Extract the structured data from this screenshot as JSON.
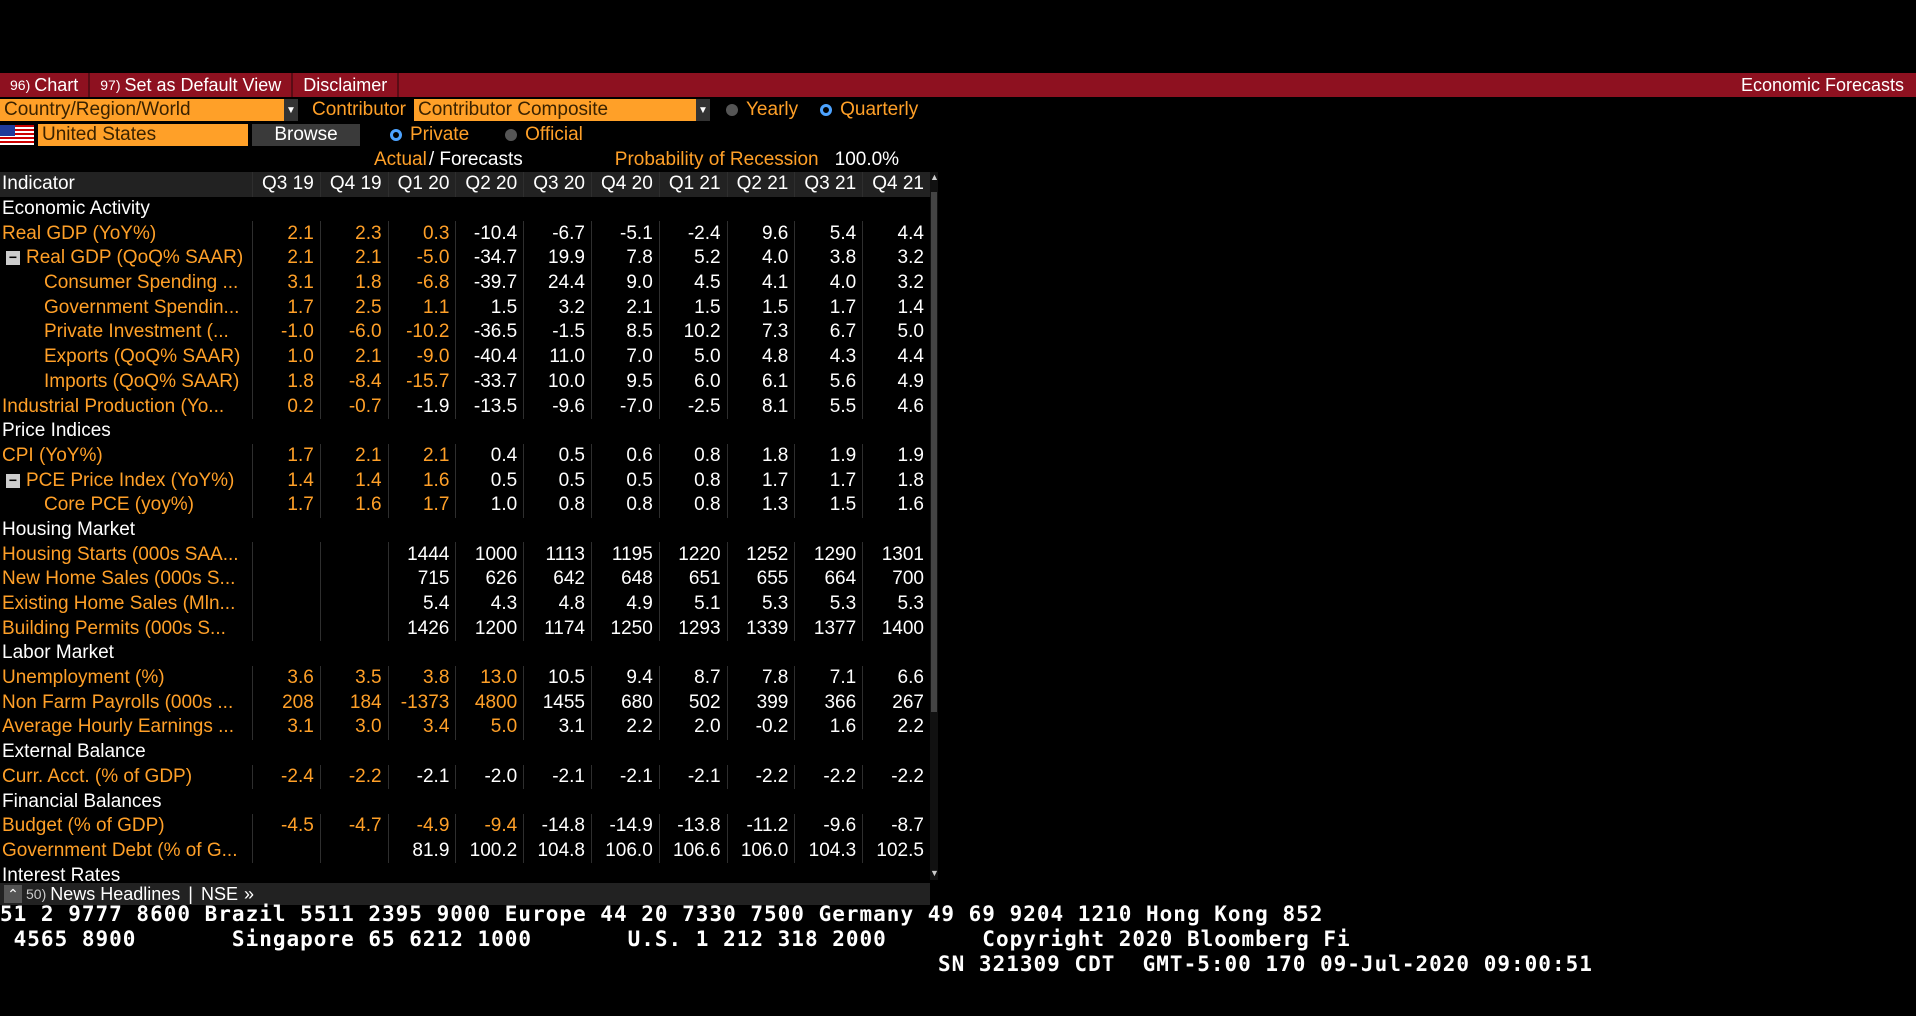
{
  "toolbar": {
    "chart_num": "96)",
    "chart_label": "Chart",
    "default_num": "97)",
    "default_label": "Set as Default View",
    "disclaimer_label": "Disclaimer",
    "title": "Economic Forecasts"
  },
  "controls": {
    "region_select": "Country/Region/World",
    "contributor_label": "Contributor",
    "contributor_select": "Contributor Composite",
    "yearly_label": "Yearly",
    "quarterly_label": "Quarterly",
    "country_field": "United States",
    "browse_label": "Browse",
    "private_label": "Private",
    "official_label": "Official",
    "actual_label": "Actual",
    "forecasts_label": "/ Forecasts",
    "recession_label": "Probability of Recession",
    "recession_value": "100.0%"
  },
  "table": {
    "header_label": "Indicator",
    "columns": [
      "Q3 19",
      "Q4 19",
      "Q1 20",
      "Q2 20",
      "Q3 20",
      "Q4 20",
      "Q1 21",
      "Q2 21",
      "Q3 21",
      "Q4 21"
    ],
    "rows": [
      {
        "type": "section",
        "label": "Economic Activity"
      },
      {
        "type": "data",
        "label": "Real GDP (YoY%)",
        "values": [
          "2.1",
          "2.3",
          "0.3",
          "-10.4",
          "-6.7",
          "-5.1",
          "-2.4",
          "9.6",
          "5.4",
          "4.4"
        ]
      },
      {
        "type": "data",
        "level": 1,
        "label": "Real GDP (QoQ% SAAR)",
        "values": [
          "2.1",
          "2.1",
          "-5.0",
          "-34.7",
          "19.9",
          "7.8",
          "5.2",
          "4.0",
          "3.8",
          "3.2"
        ]
      },
      {
        "type": "data",
        "level": 2,
        "label": "Consumer Spending ...",
        "values": [
          "3.1",
          "1.8",
          "-6.8",
          "-39.7",
          "24.4",
          "9.0",
          "4.5",
          "4.1",
          "4.0",
          "3.2"
        ]
      },
      {
        "type": "data",
        "level": 2,
        "label": "Government Spendin...",
        "values": [
          "1.7",
          "2.5",
          "1.1",
          "1.5",
          "3.2",
          "2.1",
          "1.5",
          "1.5",
          "1.7",
          "1.4"
        ]
      },
      {
        "type": "data",
        "level": 2,
        "label": "Private Investment (...",
        "values": [
          "-1.0",
          "-6.0",
          "-10.2",
          "-36.5",
          "-1.5",
          "8.5",
          "10.2",
          "7.3",
          "6.7",
          "5.0"
        ]
      },
      {
        "type": "data",
        "level": 2,
        "label": "Exports (QoQ% SAAR)",
        "values": [
          "1.0",
          "2.1",
          "-9.0",
          "-40.4",
          "11.0",
          "7.0",
          "5.0",
          "4.8",
          "4.3",
          "4.4"
        ]
      },
      {
        "type": "data",
        "level": 2,
        "label": "Imports (QoQ% SAAR)",
        "values": [
          "1.8",
          "-8.4",
          "-15.7",
          "-33.7",
          "10.0",
          "9.5",
          "6.0",
          "6.1",
          "5.6",
          "4.9"
        ]
      },
      {
        "type": "data",
        "label": "Industrial Production (Yo...",
        "values": [
          "0.2",
          "-0.7",
          "-1.9",
          "-13.5",
          "-9.6",
          "-7.0",
          "-2.5",
          "8.1",
          "5.5",
          "4.6"
        ]
      },
      {
        "type": "section",
        "label": "Price Indices"
      },
      {
        "type": "data",
        "label": "CPI (YoY%)",
        "values": [
          "1.7",
          "2.1",
          "2.1",
          "0.4",
          "0.5",
          "0.6",
          "0.8",
          "1.8",
          "1.9",
          "1.9"
        ]
      },
      {
        "type": "data",
        "level": 1,
        "label": "PCE Price Index (YoY%)",
        "values": [
          "1.4",
          "1.4",
          "1.6",
          "0.5",
          "0.5",
          "0.5",
          "0.8",
          "1.7",
          "1.7",
          "1.8"
        ]
      },
      {
        "type": "data",
        "level": 2,
        "label": "Core PCE (yoy%)",
        "values": [
          "1.7",
          "1.6",
          "1.7",
          "1.0",
          "0.8",
          "0.8",
          "0.8",
          "1.3",
          "1.5",
          "1.6"
        ]
      },
      {
        "type": "section",
        "label": "Housing Market"
      },
      {
        "type": "data",
        "label": "Housing Starts (000s SAA...",
        "values": [
          "",
          "",
          "1444",
          "1000",
          "1113",
          "1195",
          "1220",
          "1252",
          "1290",
          "1301"
        ]
      },
      {
        "type": "data",
        "label": "New Home Sales (000s S...",
        "values": [
          "",
          "",
          "715",
          "626",
          "642",
          "648",
          "651",
          "655",
          "664",
          "700"
        ]
      },
      {
        "type": "data",
        "label": "Existing Home Sales (Mln...",
        "values": [
          "",
          "",
          "5.4",
          "4.3",
          "4.8",
          "4.9",
          "5.1",
          "5.3",
          "5.3",
          "5.3"
        ]
      },
      {
        "type": "data",
        "label": "Building Permits (000s S...",
        "values": [
          "",
          "",
          "1426",
          "1200",
          "1174",
          "1250",
          "1293",
          "1339",
          "1377",
          "1400"
        ]
      },
      {
        "type": "section",
        "label": "Labor Market"
      },
      {
        "type": "data",
        "label": "Unemployment (%)",
        "values": [
          "3.6",
          "3.5",
          "3.8",
          "13.0",
          "10.5",
          "9.4",
          "8.7",
          "7.8",
          "7.1",
          "6.6"
        ]
      },
      {
        "type": "data",
        "label": "Non Farm Payrolls (000s ...",
        "values": [
          "208",
          "184",
          "-1373",
          "4800",
          "1455",
          "680",
          "502",
          "399",
          "366",
          "267"
        ]
      },
      {
        "type": "data",
        "label": "Average Hourly Earnings ...",
        "values": [
          "3.1",
          "3.0",
          "3.4",
          "5.0",
          "3.1",
          "2.2",
          "2.0",
          "-0.2",
          "1.6",
          "2.2"
        ]
      },
      {
        "type": "section",
        "label": "External Balance"
      },
      {
        "type": "data",
        "label": "Curr. Acct. (% of GDP)",
        "values": [
          "-2.4",
          "-2.2",
          "-2.1",
          "-2.0",
          "-2.1",
          "-2.1",
          "-2.1",
          "-2.2",
          "-2.2",
          "-2.2"
        ]
      },
      {
        "type": "section",
        "label": "Financial Balances"
      },
      {
        "type": "data",
        "label": "Budget (% of GDP)",
        "values": [
          "-4.5",
          "-4.7",
          "-4.9",
          "-9.4",
          "-14.8",
          "-14.9",
          "-13.8",
          "-11.2",
          "-9.6",
          "-8.7"
        ]
      },
      {
        "type": "data",
        "label": "Government Debt (% of G...",
        "values": [
          "",
          "",
          "81.9",
          "100.2",
          "104.8",
          "106.0",
          "106.6",
          "106.0",
          "104.3",
          "102.5"
        ]
      },
      {
        "type": "section",
        "label": "Interest Rates"
      }
    ]
  },
  "news": {
    "num": "50)",
    "label": "News Headlines",
    "sep": "|",
    "source": "NSE",
    "chev": "»"
  },
  "ticker": {
    "line1": "51 2 9777 8600 Brazil 5511 2395 9000 Europe 44 20 7330 7500 Germany 49 69 9204 1210 Hong Kong 852",
    "line2": " 4565 8900       Singapore 65 6212 1000       U.S. 1 212 318 2000       Copyright 2020 Bloomberg Fi",
    "line3": "SN 321309 CDT  GMT-5:00 170 09-Jul-2020 09:00:51"
  },
  "colors": {
    "accent": "#ffa028",
    "toolbar": "#8e1120",
    "radio_on": "#4da3ff"
  }
}
